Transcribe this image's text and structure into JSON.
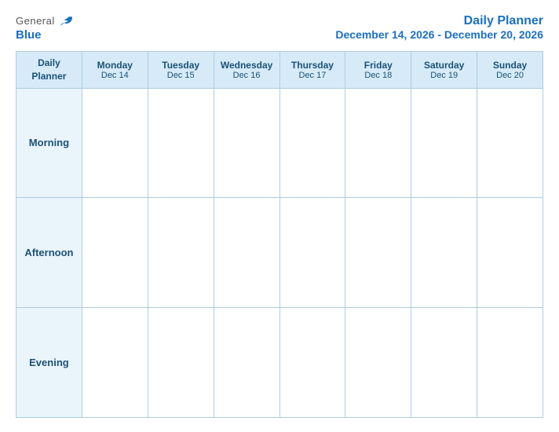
{
  "logo": {
    "general": "General",
    "blue": "Blue",
    "bird_icon": "bird-icon"
  },
  "header": {
    "title": "Daily Planner",
    "subtitle": "December 14, 2026 - December 20, 2026"
  },
  "table": {
    "columns": [
      {
        "day": "Daily\nPlanner",
        "date": ""
      },
      {
        "day": "Monday",
        "date": "Dec 14"
      },
      {
        "day": "Tuesday",
        "date": "Dec 15"
      },
      {
        "day": "Wednesday",
        "date": "Dec 16"
      },
      {
        "day": "Thursday",
        "date": "Dec 17"
      },
      {
        "day": "Friday",
        "date": "Dec 18"
      },
      {
        "day": "Saturday",
        "date": "Dec 19"
      },
      {
        "day": "Sunday",
        "date": "Dec 20"
      }
    ],
    "rows": [
      {
        "label": "Morning"
      },
      {
        "label": "Afternoon"
      },
      {
        "label": "Evening"
      }
    ]
  }
}
